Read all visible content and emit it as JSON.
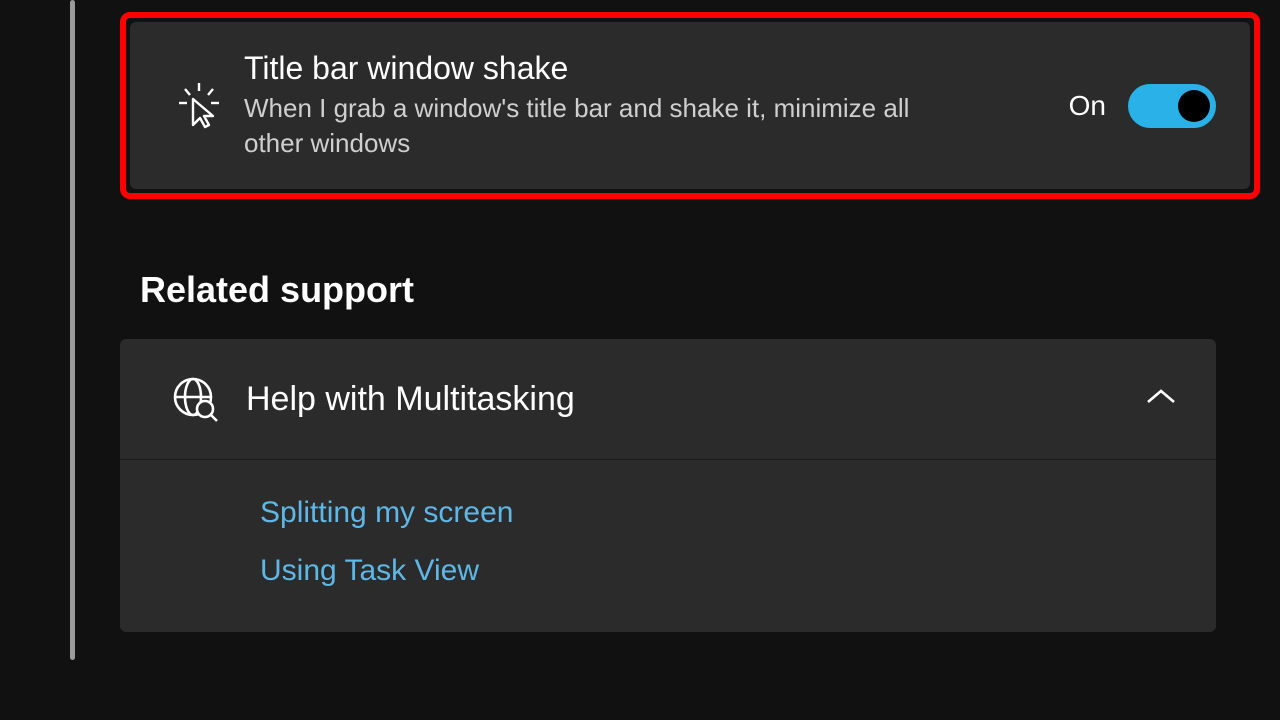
{
  "setting": {
    "title": "Title bar window shake",
    "description": "When I grab a window's title bar and shake it, minimize all other windows",
    "toggle_label": "On",
    "toggle_state": true
  },
  "related_support": {
    "heading": "Related support",
    "help_title": "Help with Multitasking",
    "expanded": true,
    "links": [
      "Splitting my screen",
      "Using Task View"
    ]
  },
  "colors": {
    "accent": "#29b1e8",
    "link": "#5fb7e6",
    "highlight": "#ff0000"
  }
}
